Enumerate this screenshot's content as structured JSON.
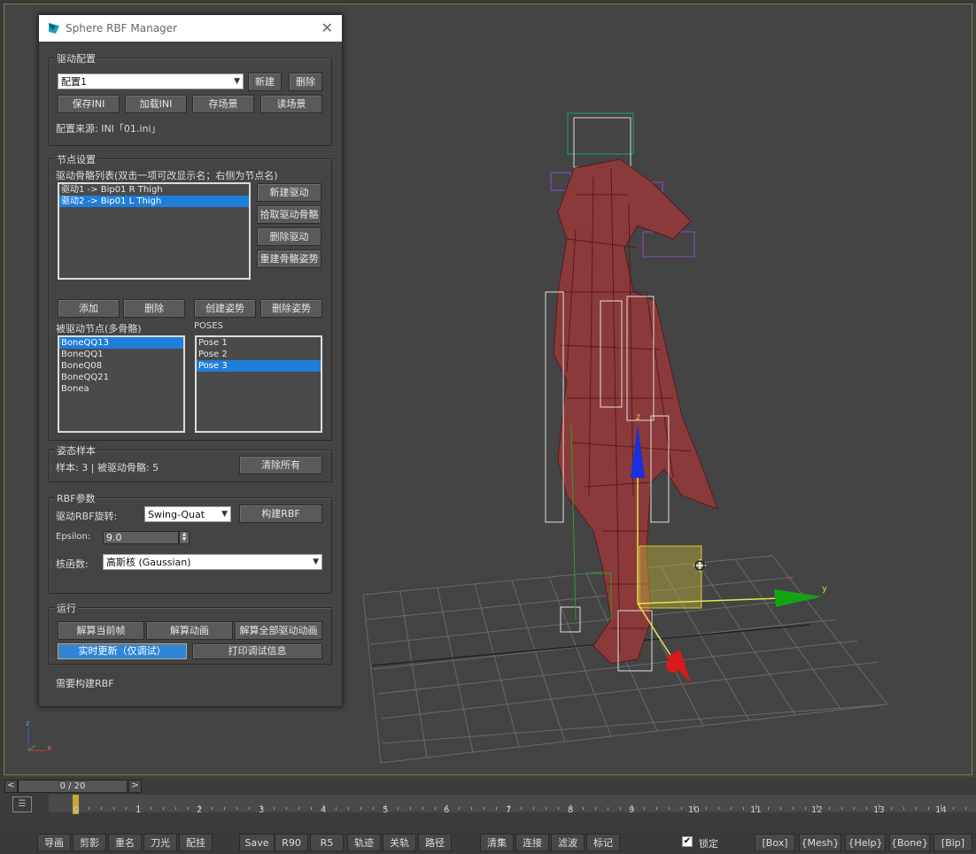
{
  "window": {
    "title": "Sphere RBF Manager",
    "close": "✕"
  },
  "drive_config": {
    "title": "驱动配置",
    "selected": "配置1",
    "new_label": "新建",
    "delete_label": "删除",
    "save_ini": "保存INI",
    "load_ini": "加载INI",
    "save_scene": "存场景",
    "read_scene": "读场景",
    "source": "配置来源: INI「01.ini」"
  },
  "node_settings": {
    "title": "节点设置",
    "drivers_label": "驱动骨骼列表(双击一项可改显示名；右侧为节点名)",
    "drivers": [
      {
        "label": "驱动1 -> Bip01 R Thigh",
        "selected": false
      },
      {
        "label": "驱动2 -> Bip01 L Thigh",
        "selected": true
      }
    ],
    "new_driver": "新建驱动",
    "pick_driver_bone": "拾取驱动骨骼",
    "delete_driver": "删除驱动",
    "rebuild_bone_pose": "重建骨骼姿势",
    "add": "添加",
    "remove": "删除",
    "create_pose": "创建姿势",
    "delete_pose": "删除姿势",
    "driven_label": "被驱动节点(多骨骼)",
    "driven": [
      {
        "label": "BoneQQ13",
        "selected": true
      },
      {
        "label": "BoneQQ1",
        "selected": false
      },
      {
        "label": "BoneQ08",
        "selected": false
      },
      {
        "label": "BoneQQ21",
        "selected": false
      },
      {
        "label": "Bonea",
        "selected": false
      }
    ],
    "poses_label": "POSES",
    "poses": [
      {
        "label": "Pose 1",
        "selected": false
      },
      {
        "label": "Pose 2",
        "selected": false
      },
      {
        "label": "Pose 3",
        "selected": true
      }
    ]
  },
  "pose_samples": {
    "title": "姿态样本",
    "info": "样本: 3 | 被驱动骨骼: 5",
    "clear_all": "清除所有"
  },
  "rbf_params": {
    "title": "RBF参数",
    "rotation_label": "驱动RBF旋转:",
    "rotation_value": "Swing-Quat",
    "build_rbf": "构建RBF",
    "epsilon_label": "Epsilon:",
    "epsilon_value": "9.0",
    "kernel_label": "核函数:",
    "kernel_value": "高斯核 (Gaussian)"
  },
  "run": {
    "title": "运行",
    "solve_frame": "解算当前帧",
    "solve_anim": "解算动画",
    "solve_all": "解算全部驱动动画",
    "realtime": "实时更新（仅调试）",
    "print_debug": "打印调试信息"
  },
  "status": "需要构建RBF",
  "viewport": {
    "axis_z": "z",
    "axis_y": "y",
    "corner_z": "z",
    "corner_x": "x"
  },
  "timeline": {
    "frame_display": "0 / 20",
    "prev": "<",
    "next": ">",
    "ticks": [
      "0",
      "1",
      "2",
      "3",
      "4",
      "5",
      "6",
      "7",
      "8",
      "9",
      "10",
      "11",
      "12",
      "13",
      "14"
    ]
  },
  "toolbar": {
    "buttons": [
      "导画",
      "剪影",
      "重名",
      "刀光",
      "配挂",
      "Save",
      "R90",
      "R5",
      "轨迹",
      "关轨",
      "路径",
      "清集",
      "连接",
      "滤波",
      "标记"
    ],
    "lock_label": "锁定",
    "lock_checked": true,
    "filters": [
      "[Box]",
      "{Mesh}",
      "{Help}",
      "{Bone}",
      "[Bip]"
    ]
  },
  "colors": {
    "selection": "#1e7ed9",
    "mesh": "#8a3a3a",
    "gizmo_z": "#1a2fe0",
    "gizmo_y": "#13a313",
    "gizmo_x": "#d81a1a"
  }
}
